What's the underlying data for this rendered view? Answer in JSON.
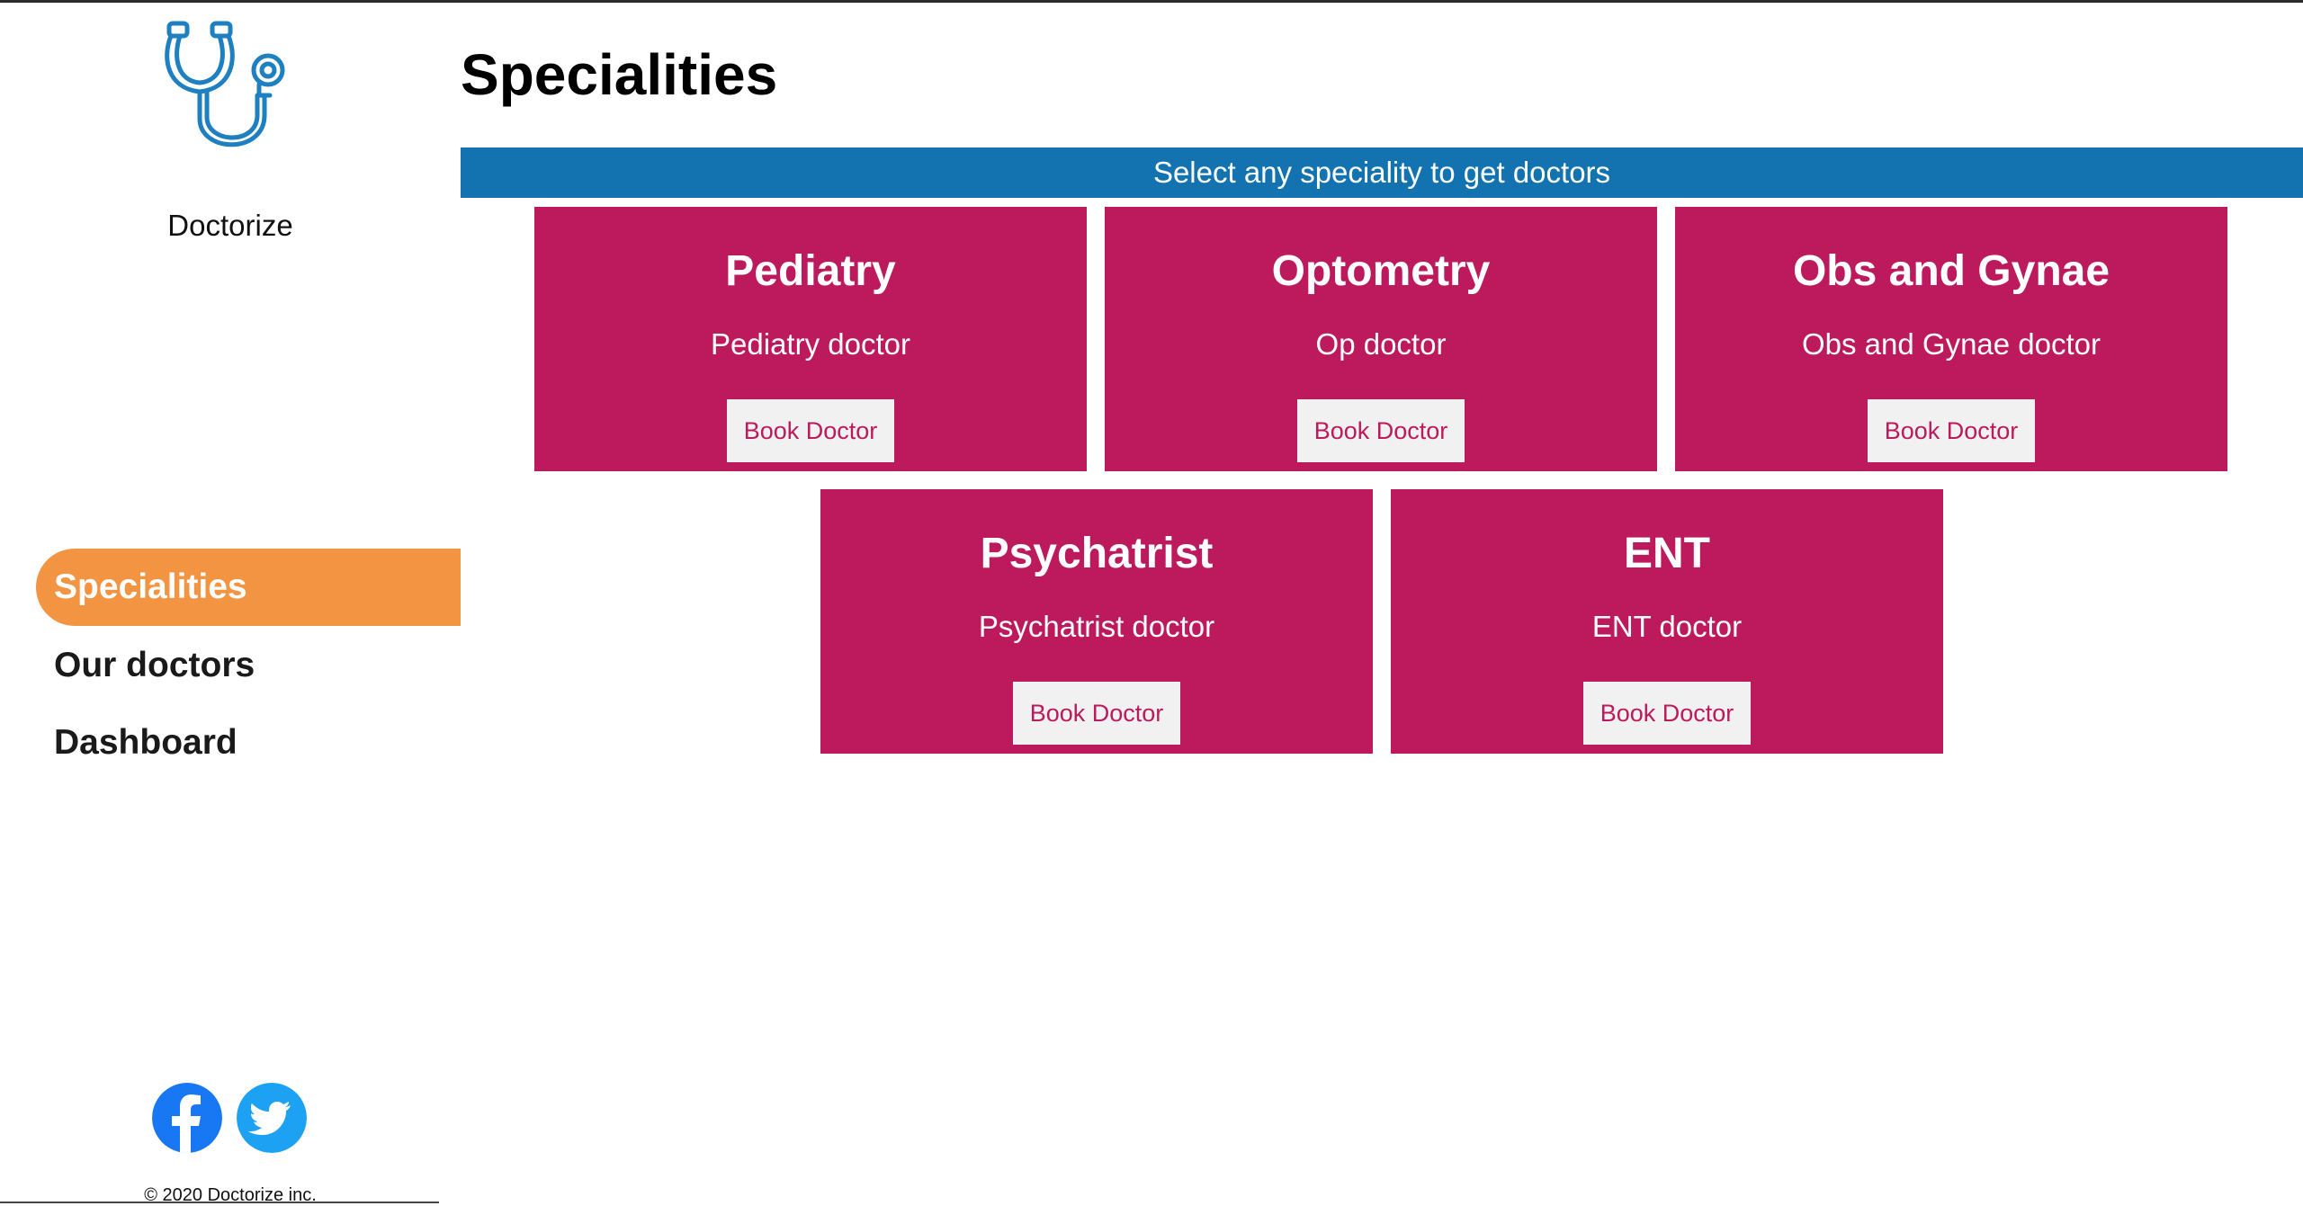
{
  "sidebar": {
    "brand": "Doctorize",
    "nav": [
      {
        "label": "Specialities",
        "active": true
      },
      {
        "label": "Our doctors",
        "active": false
      },
      {
        "label": "Dashboard",
        "active": false
      }
    ],
    "social": [
      {
        "icon": "facebook-icon",
        "color": "#1877f2"
      },
      {
        "icon": "twitter-icon",
        "color": "#1da1f2"
      }
    ],
    "footer": "© 2020 Doctorize inc."
  },
  "main": {
    "title": "Specialities",
    "banner": "Select any speciality to get doctors",
    "cards": [
      {
        "title": "Pediatry",
        "description": "Pediatry doctor",
        "button": "Book Doctor"
      },
      {
        "title": "Optometry",
        "description": "Op doctor",
        "button": "Book Doctor"
      },
      {
        "title": "Obs and Gynae",
        "description": "Obs and Gynae doctor",
        "button": "Book Doctor"
      },
      {
        "title": "Psychatrist",
        "description": "Psychatrist doctor",
        "button": "Book Doctor"
      },
      {
        "title": "ENT",
        "description": "ENT doctor",
        "button": "Book Doctor"
      }
    ]
  },
  "colors": {
    "accent_active": "#f29441",
    "banner": "#1273b0",
    "card": "#bc1a5c",
    "button_bg": "#f1f1f1",
    "logo": "#1e7fc1"
  }
}
